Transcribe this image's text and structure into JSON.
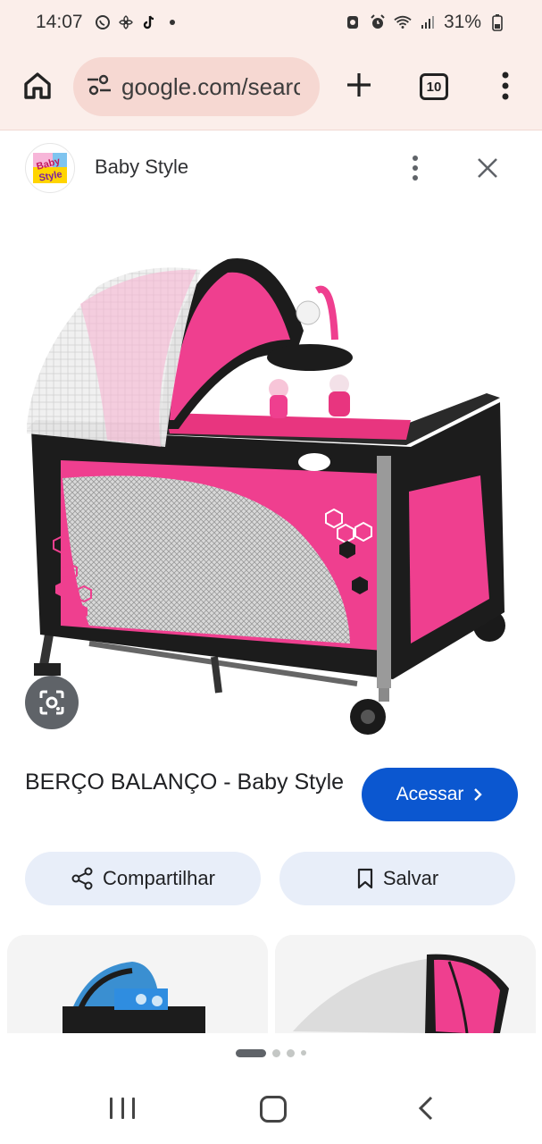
{
  "status_bar": {
    "time": "14:07",
    "battery": "31%",
    "left_icons": [
      "whatsapp-icon",
      "fan-icon",
      "tiktok-icon",
      "dot-icon"
    ],
    "right_icons": [
      "nfc-icon",
      "alarm-icon",
      "wifi-icon",
      "signal-icon",
      "battery-icon"
    ]
  },
  "browser": {
    "url": "google.com/search",
    "tab_count": "10"
  },
  "source": {
    "name": "Baby Style",
    "logo_text": "Baby Style"
  },
  "result": {
    "title": "BERÇO BALANÇO - Baby Style",
    "visit_label": "Acessar",
    "share_label": "Compartilhar",
    "save_label": "Salvar"
  },
  "colors": {
    "accent": "#0b57d0",
    "toolbar_bg": "#fbeeea",
    "product_pink": "#e83e8c"
  }
}
